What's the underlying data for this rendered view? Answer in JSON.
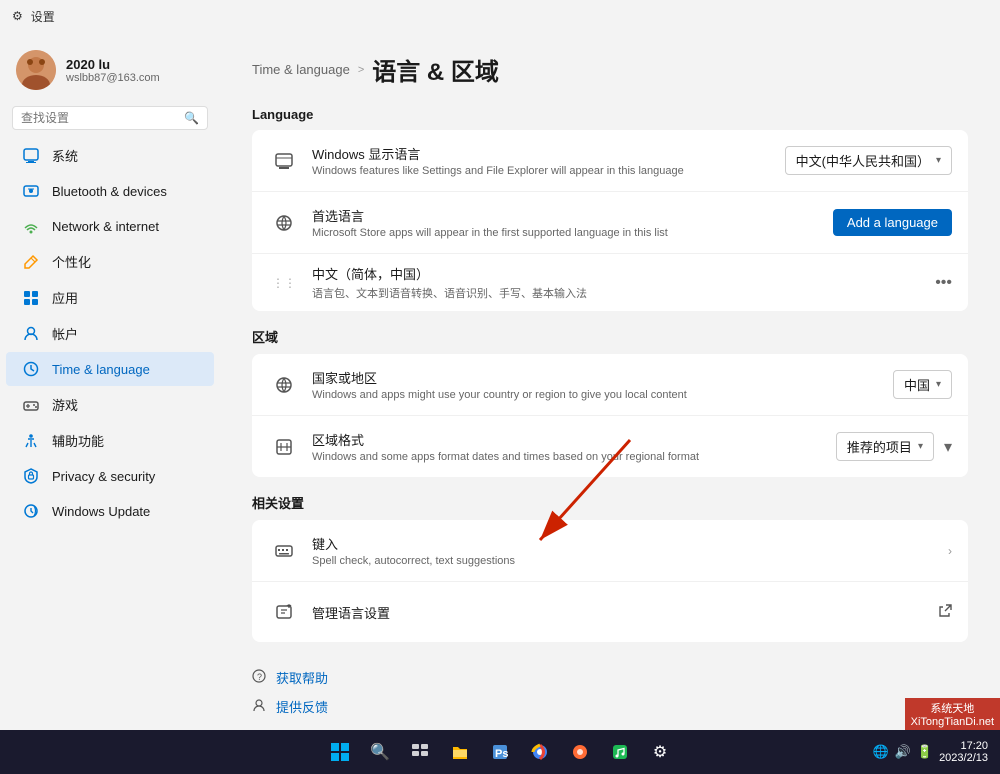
{
  "titleBar": {
    "icon": "⚙",
    "title": "设置"
  },
  "user": {
    "name": "2020 lu",
    "email": "wslbb87@163.com"
  },
  "search": {
    "placeholder": "查找设置"
  },
  "nav": {
    "items": [
      {
        "id": "system",
        "label": "系统",
        "icon": "system"
      },
      {
        "id": "bluetooth",
        "label": "Bluetooth & devices",
        "icon": "bluetooth"
      },
      {
        "id": "network",
        "label": "Network & internet",
        "icon": "network"
      },
      {
        "id": "personalize",
        "label": "个性化",
        "icon": "personalize"
      },
      {
        "id": "apps",
        "label": "应用",
        "icon": "apps"
      },
      {
        "id": "accounts",
        "label": "帐户",
        "icon": "accounts"
      },
      {
        "id": "timelang",
        "label": "Time & language",
        "icon": "timelang",
        "active": true
      },
      {
        "id": "gaming",
        "label": "游戏",
        "icon": "gaming"
      },
      {
        "id": "accessibility",
        "label": "辅助功能",
        "icon": "accessibility"
      },
      {
        "id": "privacy",
        "label": "Privacy & security",
        "icon": "privacy"
      },
      {
        "id": "update",
        "label": "Windows Update",
        "icon": "update"
      }
    ]
  },
  "breadcrumb": {
    "parent": "Time & language",
    "separator": ">",
    "current": "语言 & 区域"
  },
  "sections": {
    "language": {
      "title": "Language",
      "displayLanguage": {
        "title": "Windows 显示语言",
        "desc": "Windows features like Settings and File Explorer will appear in this language",
        "value": "中文(中华人民共和国）"
      },
      "preferredLanguage": {
        "title": "首选语言",
        "desc": "Microsoft Store apps will appear in the first supported language in this list",
        "buttonLabel": "Add a language"
      },
      "chinese": {
        "title": "中文（简体，中国）",
        "desc": "语言包、文本到语音转换、语音识别、手写、基本输入法"
      }
    },
    "region": {
      "title": "区域",
      "country": {
        "title": "国家或地区",
        "desc": "Windows and apps might use your country or region to give you local content",
        "value": "中国"
      },
      "format": {
        "title": "区域格式",
        "desc": "Windows and some apps format dates and times based on your regional format",
        "value": "推荐的项目"
      }
    },
    "related": {
      "title": "相关设置",
      "typing": {
        "title": "键入",
        "desc": "Spell check, autocorrect, text suggestions"
      },
      "manageLang": {
        "title": "管理语言设置"
      }
    }
  },
  "helpLinks": [
    {
      "id": "help",
      "label": "获取帮助",
      "icon": "?"
    },
    {
      "id": "feedback",
      "label": "提供反馈",
      "icon": "👤"
    }
  ],
  "taskbar": {
    "centerIcons": [
      "⊞",
      "🔍",
      "▣",
      "📁",
      "📷",
      "🌐",
      "◉",
      "🎵",
      "⚙"
    ],
    "time": "17:20",
    "date": "2023/2/13"
  },
  "watermark": {
    "line1": "系统天地",
    "line2": "XiTongTianDi.net"
  }
}
